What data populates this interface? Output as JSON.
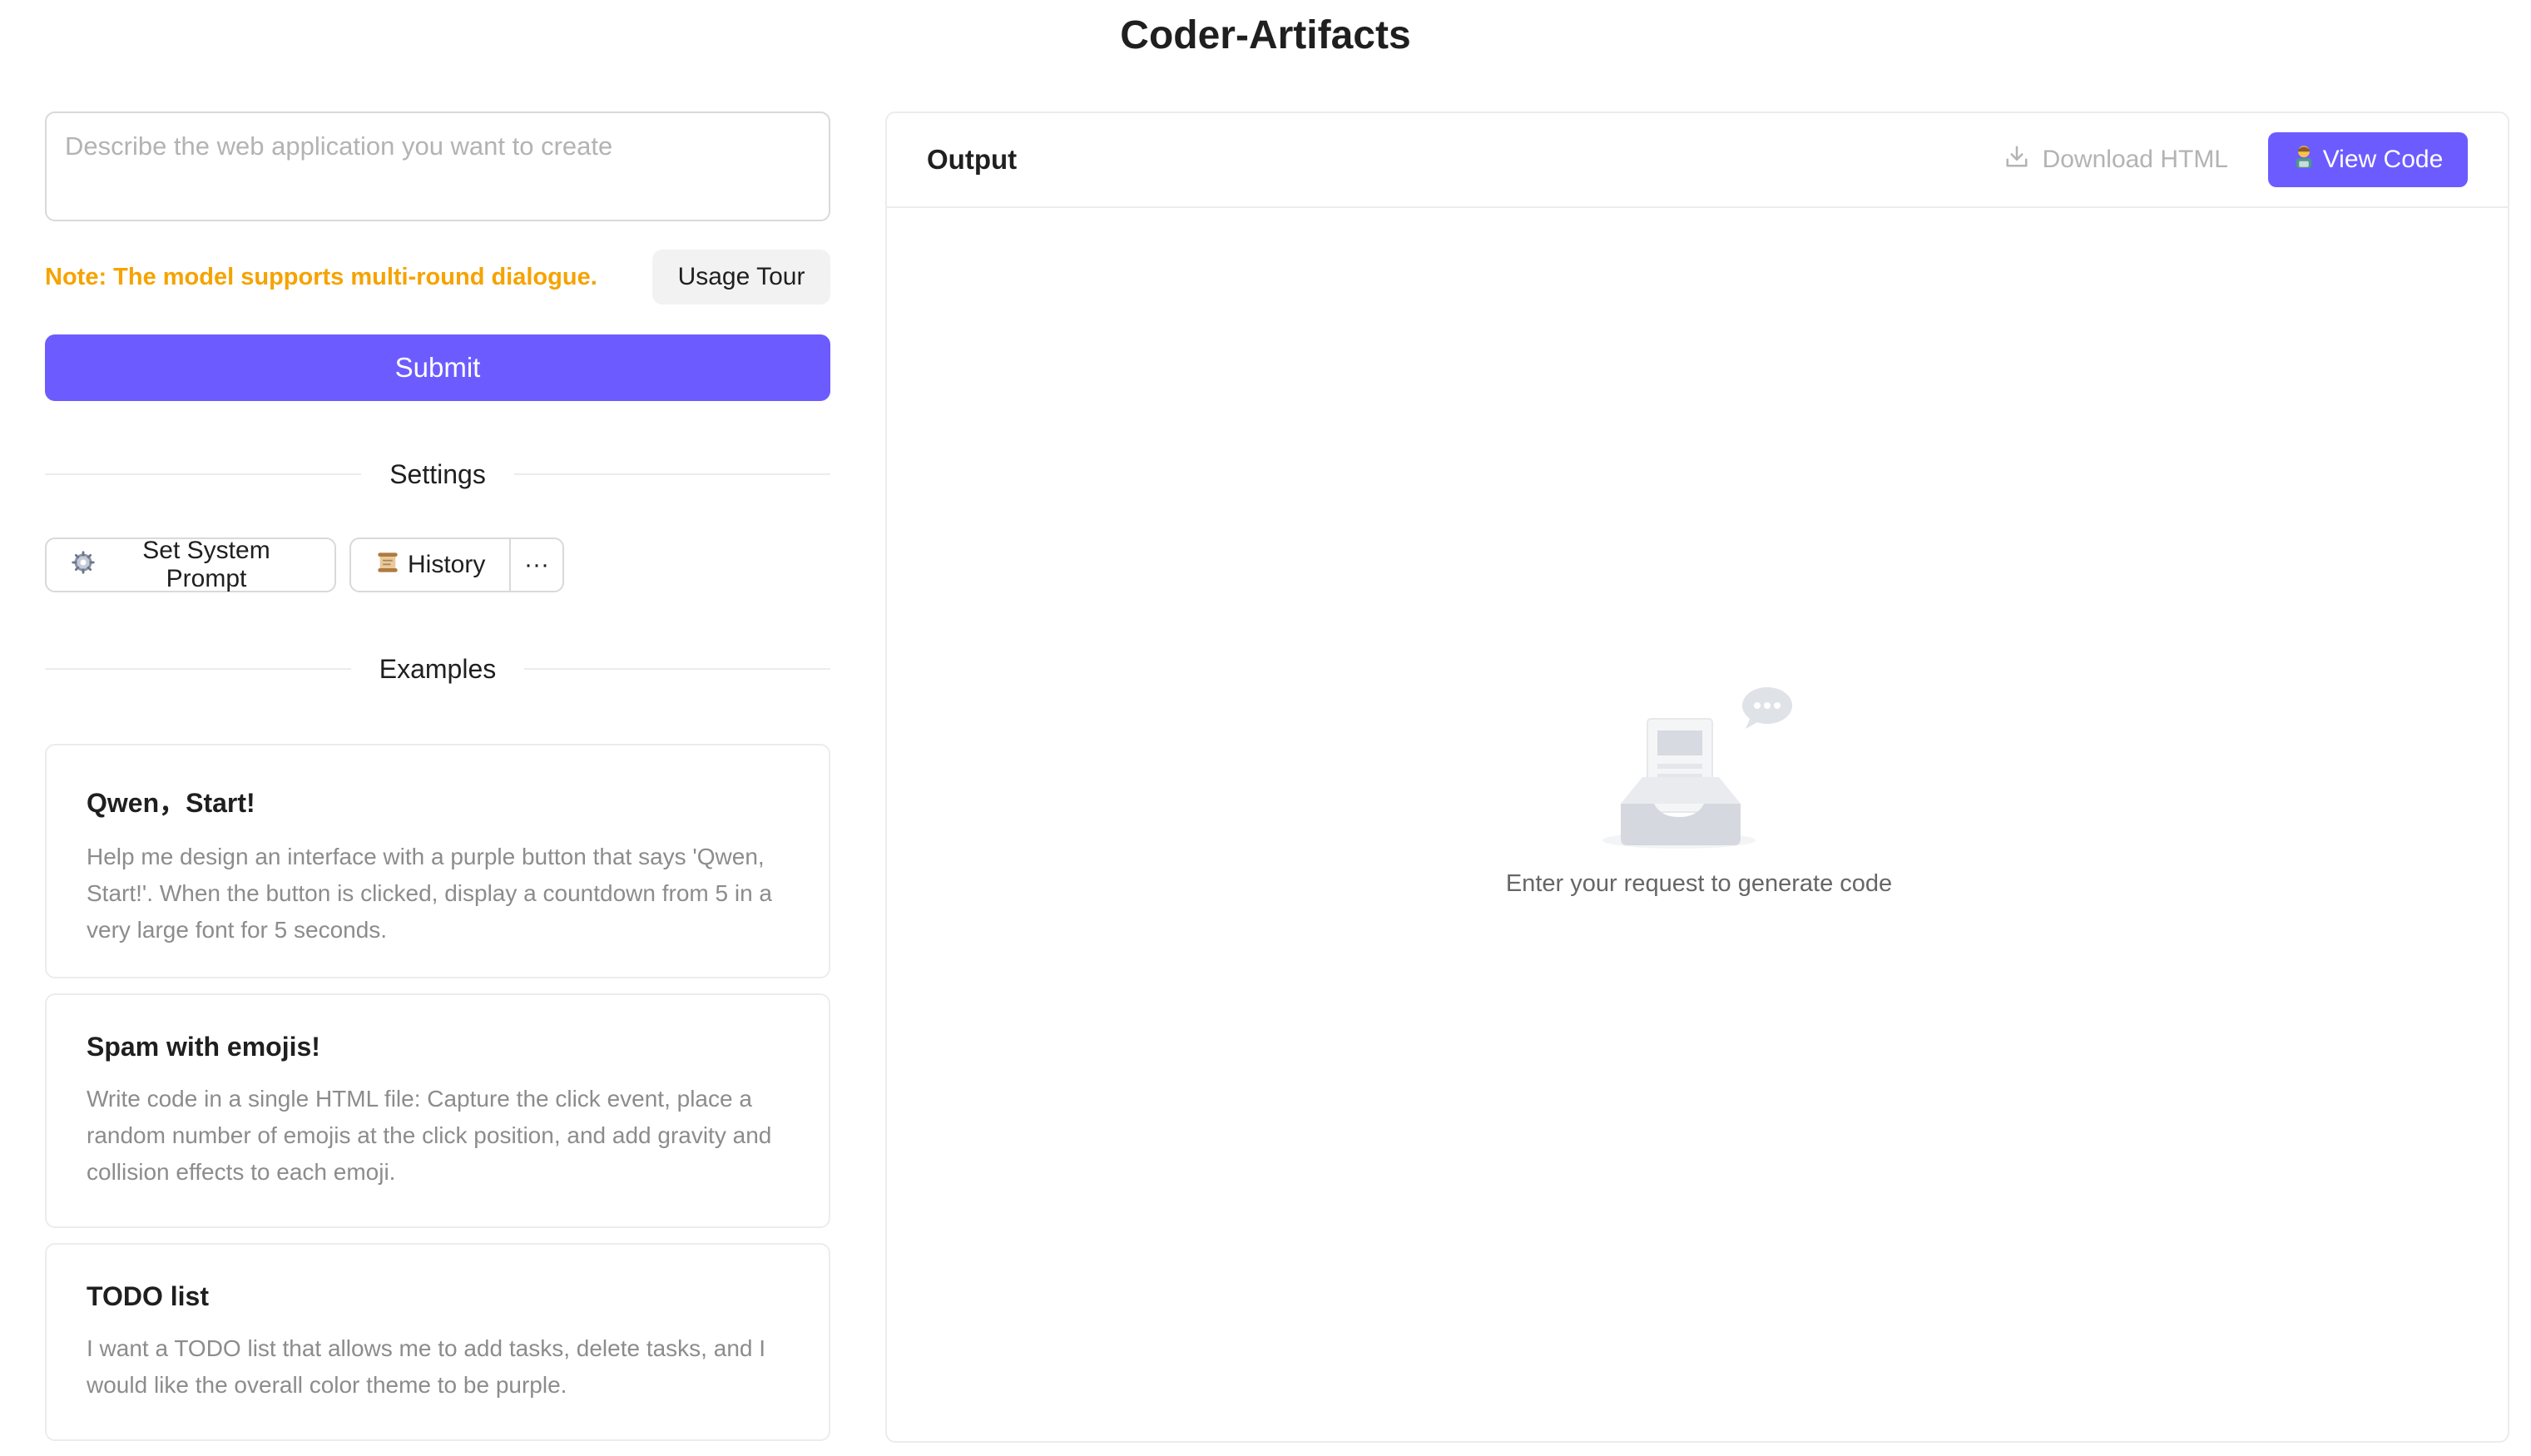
{
  "app": {
    "title": "Coder-Artifacts"
  },
  "input": {
    "placeholder": "Describe the web application you want to create",
    "value": ""
  },
  "note": {
    "text": "Note: The model supports multi-round dialogue."
  },
  "buttons": {
    "usage_tour": "Usage Tour",
    "submit": "Submit"
  },
  "settings": {
    "title": "Settings",
    "set_system_prompt": "Set System Prompt",
    "history": "History",
    "more": "···",
    "set_system_prompt_icon": "gear-icon",
    "history_icon": "scroll-icon"
  },
  "examples": {
    "title": "Examples",
    "items": [
      {
        "title": "Qwen，Start!",
        "description": "Help me design an interface with a purple button that says 'Qwen, Start!'. When the button is clicked, display a countdown from 5 in a very large font for 5 seconds."
      },
      {
        "title": "Spam with emojis!",
        "description": "Write code in a single HTML file: Capture the click event, place a random number of emojis at the click position, and add gravity and collision effects to each emoji."
      },
      {
        "title": "TODO list",
        "description": "I want a TODO list that allows me to add tasks, delete tasks, and I would like the overall color theme to be purple."
      }
    ]
  },
  "output": {
    "title": "Output",
    "download_html": "Download HTML",
    "view_code": "View Code",
    "empty_text": "Enter your request to generate code"
  },
  "colors": {
    "accent": "#6c5cff",
    "note": "#f5a300",
    "border": "#ececec",
    "muted_text": "#8c8c8c"
  }
}
